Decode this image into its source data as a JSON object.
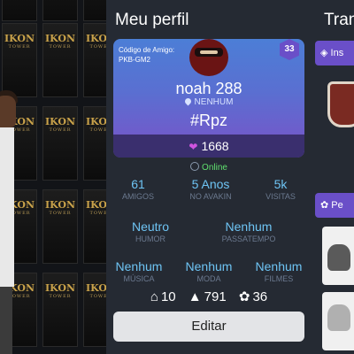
{
  "background": {
    "poster_title": "IKON",
    "poster_subtitle": "TOWER"
  },
  "profile": {
    "title": "Meu perfil",
    "friend_code_label": "Código de Amigo:",
    "friend_code": "PKB-GM2",
    "level": "33",
    "username": "noah 288",
    "location": "NENHUM",
    "tag": "#Rpz",
    "hearts": "1668",
    "status": "Online"
  },
  "stats_row1": [
    {
      "value": "61",
      "label": "AMIGOS"
    },
    {
      "value": "5 Anos",
      "label": "NO AVAKIN"
    },
    {
      "value": "5k",
      "label": "VISITAS"
    }
  ],
  "stats_row2": [
    {
      "value": "Neutro",
      "label": "HUMOR"
    },
    {
      "value": "Nenhum",
      "label": "PASSATEMPO"
    }
  ],
  "stats_row3": [
    {
      "value": "Nenhum",
      "label": "MÚSICA"
    },
    {
      "value": "Nenhum",
      "label": "MODA"
    },
    {
      "value": "Nenhum",
      "label": "FILMES"
    }
  ],
  "counts": {
    "homes": "10",
    "outfits": "791",
    "pets": "36"
  },
  "edit_label": "Editar",
  "right_panel": {
    "title": "Tran",
    "bar1_label": "Ins",
    "bar2_label": "Pe"
  },
  "colors": {
    "accent_purple": "#6a4fc8",
    "stat_blue": "#6ec4f4",
    "online_green": "#5fe06e"
  }
}
